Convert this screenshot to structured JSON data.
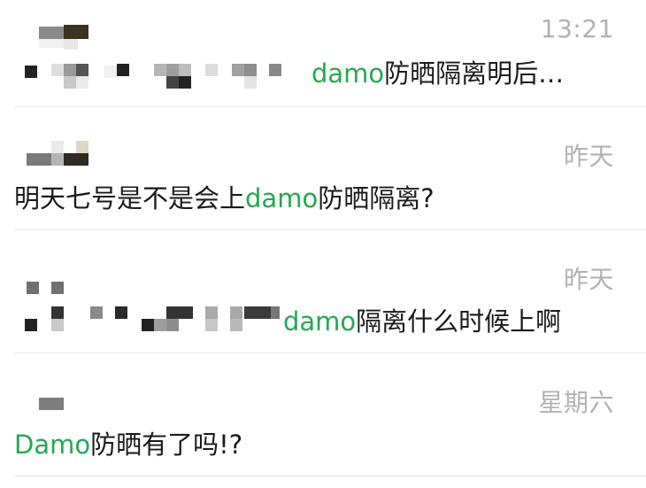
{
  "chats": [
    {
      "time": "13:21",
      "mention": "damo",
      "text": "防晒隔离明后…",
      "sender_redacted": true
    },
    {
      "time": "昨天",
      "prefix": "明天七号是不是会上",
      "mention": "damo",
      "text": "防晒隔离?",
      "sender_redacted": true
    },
    {
      "time": "昨天",
      "mention": "damo",
      "text": "隔离什么时候上啊",
      "sender_redacted": true
    },
    {
      "time": "星期六",
      "mention": "Damo",
      "text": "防晒有了吗!?",
      "sender_redacted": true
    }
  ],
  "colors": {
    "mention": "#23a94f",
    "time": "#b2b2b2",
    "text": "#1a1a1a",
    "divider": "#e6e6e6"
  }
}
